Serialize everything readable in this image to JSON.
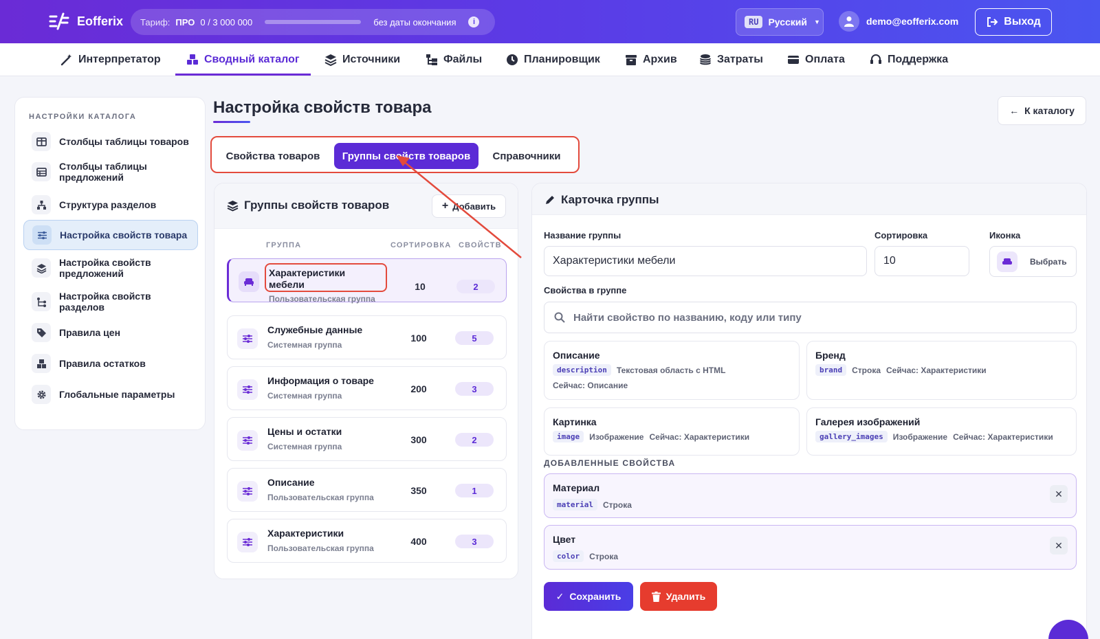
{
  "header": {
    "brand": "Eofferix",
    "tariff_label": "Тариф:",
    "tariff_plan": "ПРО",
    "tariff_usage": "0 / 3 000 000",
    "tariff_usage_fraction": 0,
    "tariff_period": "без даты окончания",
    "lang_code": "RU",
    "lang_name": "Русский",
    "user_email": "demo@eofferix.com",
    "logout_label": "Выход"
  },
  "nav": [
    {
      "label": "Интерпретатор",
      "icon": "wand-icon"
    },
    {
      "label": "Сводный каталог",
      "icon": "boxes-icon",
      "active": true
    },
    {
      "label": "Источники",
      "icon": "layers-icon"
    },
    {
      "label": "Файлы",
      "icon": "folder-tree-icon"
    },
    {
      "label": "Планировщик",
      "icon": "clock-icon"
    },
    {
      "label": "Архив",
      "icon": "archive-icon"
    },
    {
      "label": "Затраты",
      "icon": "coins-icon"
    },
    {
      "label": "Оплата",
      "icon": "card-icon"
    },
    {
      "label": "Поддержка",
      "icon": "headset-icon"
    }
  ],
  "sidebar": {
    "title": "НАСТРОЙКИ КАТАЛОГА",
    "items": [
      {
        "label": "Столбцы таблицы товаров",
        "icon": "columns-icon"
      },
      {
        "label": "Столбцы таблицы предложений",
        "icon": "table-icon"
      },
      {
        "label": "Структура разделов",
        "icon": "sitemap-icon"
      },
      {
        "label": "Настройка свойств товара",
        "icon": "sliders-icon",
        "active": true
      },
      {
        "label": "Настройка свойств предложений",
        "icon": "layers-icon"
      },
      {
        "label": "Настройка свойств разделов",
        "icon": "tree-icon"
      },
      {
        "label": "Правила цен",
        "icon": "tag-icon"
      },
      {
        "label": "Правила остатков",
        "icon": "boxes-icon"
      },
      {
        "label": "Глобальные параметры",
        "icon": "gear-icon"
      }
    ]
  },
  "page": {
    "title": "Настройка свойств товара",
    "back_label": "К каталогу",
    "tabs": [
      {
        "label": "Свойства товаров"
      },
      {
        "label": "Группы свойств товаров",
        "active": true
      },
      {
        "label": "Справочники"
      }
    ]
  },
  "groups": {
    "title": "Группы свойств товаров",
    "add_label": "Добавить",
    "columns": [
      "ГРУППА",
      "СОРТИРОВКА",
      "СВОЙСТВ"
    ],
    "rows": [
      {
        "name": "Характеристики мебели",
        "sub": "Пользовательская группа",
        "sort": "10",
        "count": "2",
        "icon": "sofa-icon",
        "active": true
      },
      {
        "name": "Служебные данные",
        "sub": "Системная группа",
        "sort": "100",
        "count": "5",
        "icon": "sliders-icon"
      },
      {
        "name": "Информация о товаре",
        "sub": "Системная группа",
        "sort": "200",
        "count": "3",
        "icon": "sliders-icon"
      },
      {
        "name": "Цены и остатки",
        "sub": "Системная группа",
        "sort": "300",
        "count": "2",
        "icon": "sliders-icon"
      },
      {
        "name": "Описание",
        "sub": "Пользовательская группа",
        "sort": "350",
        "count": "1",
        "icon": "sliders-icon"
      },
      {
        "name": "Характеристики",
        "sub": "Пользовательская группа",
        "sort": "400",
        "count": "3",
        "icon": "sliders-icon"
      }
    ]
  },
  "card": {
    "title": "Карточка группы",
    "name_label": "Название группы",
    "name_value": "Характеристики мебели",
    "sort_label": "Сортировка",
    "sort_value": "10",
    "icon_label": "Иконка",
    "icon_choose": "Выбрать",
    "props_label": "Свойства в группе",
    "search_placeholder": "Найти свойство по названию, коду или типу",
    "available": [
      {
        "name": "Описание",
        "code": "description",
        "type": "Текстовая область с HTML",
        "current": "Сейчас: Описание"
      },
      {
        "name": "Бренд",
        "code": "brand",
        "type": "Строка",
        "current": "Сейчас: Характеристики"
      },
      {
        "name": "Картинка",
        "code": "image",
        "type": "Изображение",
        "current": "Сейчас: Характеристики"
      },
      {
        "name": "Галерея изображений",
        "code": "gallery_images",
        "type": "Изображение",
        "current": "Сейчас: Характеристики"
      }
    ],
    "added_label": "ДОБАВЛЕННЫЕ СВОЙСТВА",
    "added": [
      {
        "name": "Материал",
        "code": "material",
        "type": "Строка"
      },
      {
        "name": "Цвет",
        "code": "color",
        "type": "Строка"
      }
    ],
    "save_label": "Сохранить",
    "delete_label": "Удалить"
  },
  "colors": {
    "accent": "#5b2bd6",
    "danger": "#e63c2e",
    "annotation": "#e34a3c"
  }
}
